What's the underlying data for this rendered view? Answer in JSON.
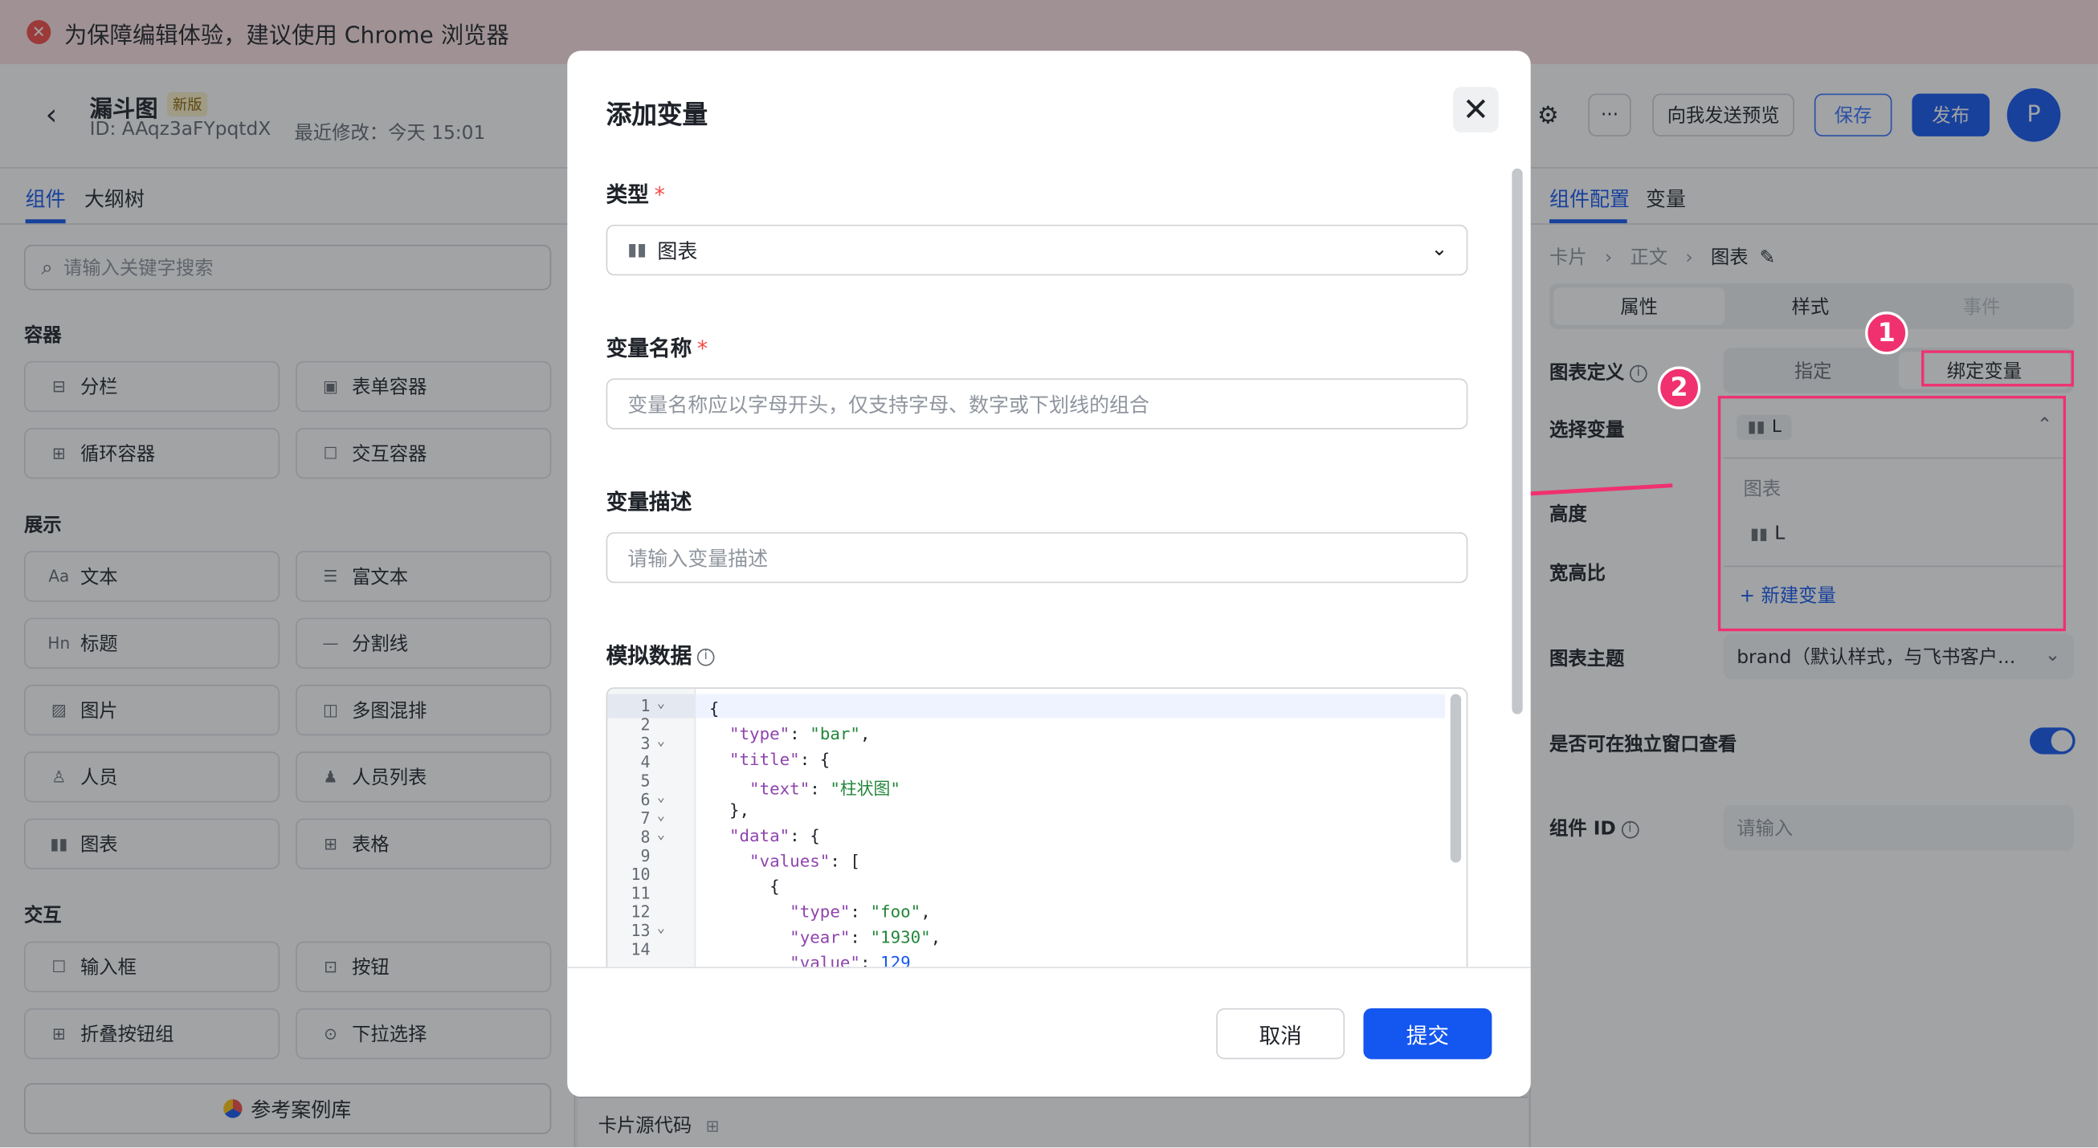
{
  "banner": {
    "text": "为保障编辑体验，建议使用 Chrome 浏览器",
    "icon": "error-circle-icon"
  },
  "header": {
    "back_icon": "chevron-left-icon",
    "title": "漏斗图",
    "badge": "新版",
    "id_text": "ID: AAqz3aFYpqtdX",
    "modified": "最近修改：今天 15:01",
    "robot_icon": "robot-icon",
    "more_label": "···",
    "preview_label": "向我发送预览",
    "save_label": "保存",
    "publish_label": "发布",
    "avatar_letter": "P"
  },
  "left": {
    "tabs": [
      "组件",
      "大纲树"
    ],
    "search_placeholder": "请输入关键字搜索",
    "groups": [
      {
        "title": "容器",
        "items": [
          {
            "label": "分栏",
            "icon": "columns-icon",
            "glyph": "⊟"
          },
          {
            "label": "表单容器",
            "icon": "form-container-icon",
            "glyph": "▣"
          },
          {
            "label": "循环容器",
            "icon": "loop-container-icon",
            "glyph": "⊞"
          },
          {
            "label": "交互容器",
            "icon": "interactive-container-icon",
            "glyph": "☐"
          }
        ]
      },
      {
        "title": "展示",
        "items": [
          {
            "label": "文本",
            "icon": "text-icon",
            "glyph": "Aa"
          },
          {
            "label": "富文本",
            "icon": "rich-text-icon",
            "glyph": "☰"
          },
          {
            "label": "标题",
            "icon": "heading-icon",
            "glyph": "Hn"
          },
          {
            "label": "分割线",
            "icon": "divider-icon",
            "glyph": "—"
          },
          {
            "label": "图片",
            "icon": "image-icon",
            "glyph": "▨"
          },
          {
            "label": "多图混排",
            "icon": "multi-image-icon",
            "glyph": "◫"
          },
          {
            "label": "人员",
            "icon": "person-icon",
            "glyph": "♙"
          },
          {
            "label": "人员列表",
            "icon": "person-list-icon",
            "glyph": "♟"
          },
          {
            "label": "图表",
            "icon": "chart-icon",
            "glyph": "▮▮"
          },
          {
            "label": "表格",
            "icon": "table-icon",
            "glyph": "⊞"
          }
        ]
      },
      {
        "title": "交互",
        "items": [
          {
            "label": "输入框",
            "icon": "input-icon",
            "glyph": "☐"
          },
          {
            "label": "按钮",
            "icon": "button-icon",
            "glyph": "⊡"
          },
          {
            "label": "折叠按钮组",
            "icon": "collapse-group-icon",
            "glyph": "⊞"
          },
          {
            "label": "下拉选择",
            "icon": "dropdown-icon",
            "glyph": "⊙"
          }
        ]
      }
    ],
    "library_label": "参考案例库"
  },
  "center": {
    "source_label": "卡片源代码"
  },
  "right": {
    "tabs": [
      "组件配置",
      "变量"
    ],
    "breadcrumb": [
      "卡片",
      "正文",
      "图表"
    ],
    "segments": [
      "属性",
      "样式",
      "事件"
    ],
    "chart_def_label": "图表定义",
    "chart_def_options": [
      "指定",
      "绑定变量"
    ],
    "select_var_label": "选择变量",
    "selected_var": "L",
    "dropdown_group": "图表",
    "dropdown_item": "L",
    "new_var_label": "+ 新建变量",
    "height_label": "高度",
    "ratio_label": "宽高比",
    "theme_label": "图表主题",
    "theme_value": "brand（默认样式，与飞书客户...",
    "window_label": "是否可在独立窗口查看",
    "window_enabled": true,
    "compid_label": "组件 ID",
    "compid_placeholder": "请输入"
  },
  "annotations": {
    "marker1": "1",
    "marker2": "2",
    "color": "#f0306f"
  },
  "modal": {
    "title": "添加变量",
    "type_label": "类型",
    "type_value": "图表",
    "name_label": "变量名称",
    "name_placeholder": "变量名称应以字母开头，仅支持字母、数字或下划线的组合",
    "desc_label": "变量描述",
    "desc_placeholder": "请输入变量描述",
    "mock_label": "模拟数据",
    "code_lines": [
      "{",
      "  \"type\": \"bar\",",
      "  \"title\": {",
      "    \"text\": \"柱状图\"",
      "  },",
      "  \"data\": {",
      "    \"values\": [",
      "      {",
      "        \"type\": \"foo\",",
      "        \"year\": \"1930\",",
      "        \"value\": 129"
    ],
    "line_numbers": [
      "1",
      "2",
      "3",
      "4",
      "5",
      "6",
      "7",
      "8",
      "9",
      "10",
      "11",
      "12",
      "13",
      "14"
    ],
    "cancel_label": "取消",
    "submit_label": "提交"
  },
  "colors": {
    "primary": "#1456f0",
    "danger": "#f54a45",
    "highlight": "#f0306f"
  }
}
